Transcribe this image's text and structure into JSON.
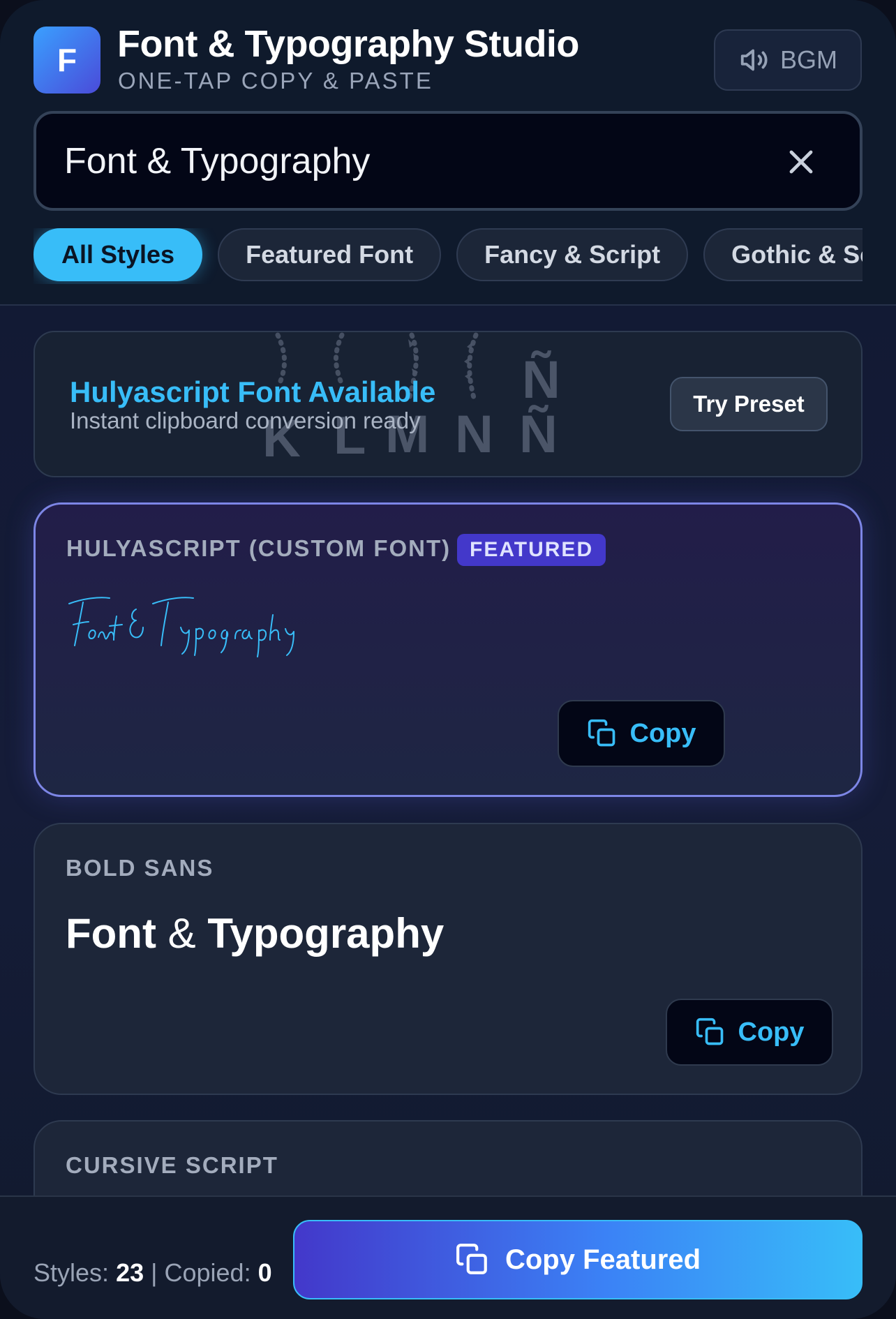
{
  "app": {
    "logo_letter": "F",
    "title": "Font & Typography Studio",
    "subtitle": "ONE-TAP COPY & PASTE",
    "bgm_label": "BGM"
  },
  "search": {
    "value": "Font & Typography",
    "clear_icon": "close-icon"
  },
  "filters": [
    {
      "label": "All Styles",
      "active": true
    },
    {
      "label": "Featured Font",
      "active": false
    },
    {
      "label": "Fancy & Script",
      "active": false
    },
    {
      "label": "Gothic & Script",
      "active": false
    }
  ],
  "banner": {
    "title": "Hulyascript Font Available",
    "subtitle": "Instant clipboard conversion ready",
    "button_label": "Try Preset",
    "decor_letters": [
      "K",
      "L",
      "M",
      "N",
      "Ñ",
      "Ñ"
    ]
  },
  "cards": [
    {
      "label": "HULYASCRIPT (CUSTOM FONT)",
      "badge": "FEATURED",
      "preview": "Font & Typography",
      "copy_label": "Copy"
    },
    {
      "label": "BOLD SANS",
      "preview_a": "Font",
      "preview_amp": "&",
      "preview_b": "Typography",
      "copy_label": "Copy"
    },
    {
      "label": "CURSIVE SCRIPT"
    }
  ],
  "footer": {
    "styles_label": "Styles:",
    "styles_count": "23",
    "separator": "|",
    "copied_label": "Copied:",
    "copied_count": "0",
    "button_label": "Copy Featured"
  },
  "colors": {
    "accent": "#38bdf8",
    "featured_badge": "#4338ca",
    "background": "#101a2e"
  }
}
